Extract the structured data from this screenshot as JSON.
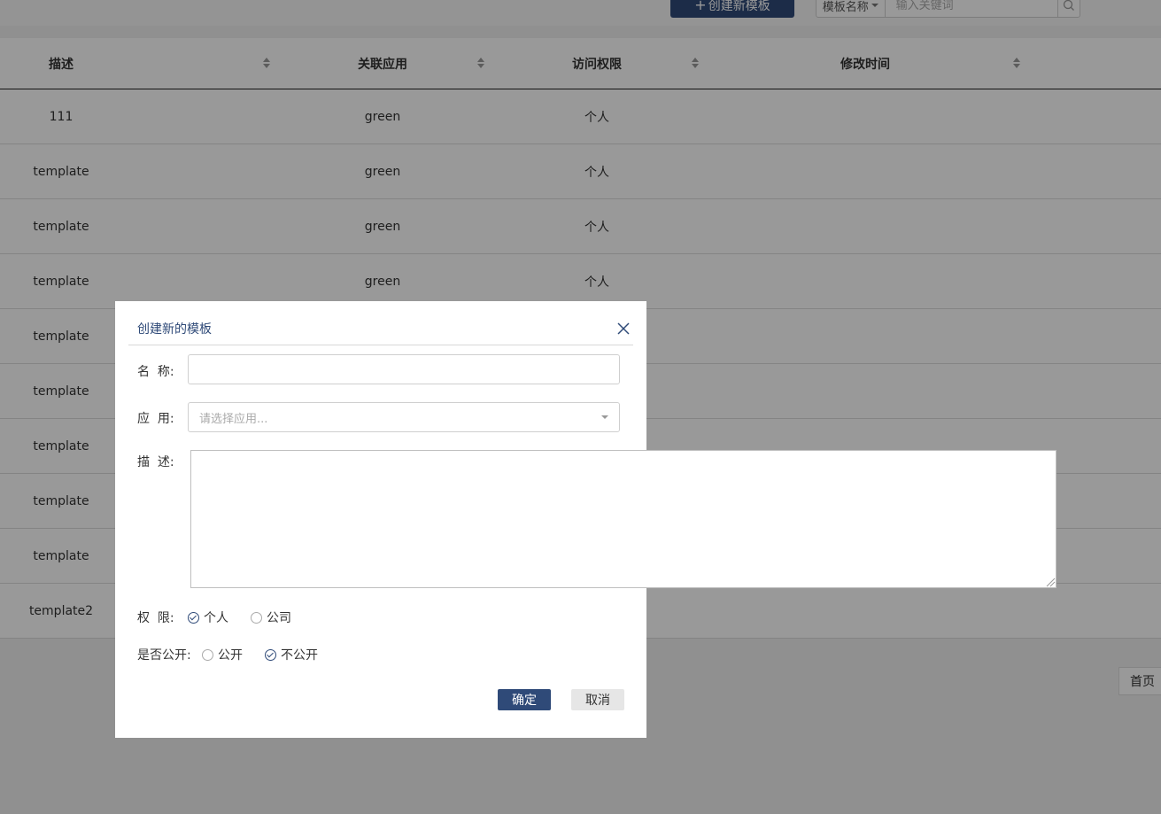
{
  "toolbar": {
    "create_label": "创建新模板",
    "search_type_label": "模板名称",
    "search_placeholder": "输入关键词"
  },
  "table": {
    "headers": [
      "描述",
      "关联应用",
      "访问权限",
      "修改时间"
    ],
    "rows": [
      {
        "desc": "111",
        "app": "green",
        "access": "个人",
        "time": ""
      },
      {
        "desc": "template",
        "app": "green",
        "access": "个人",
        "time": ""
      },
      {
        "desc": "template",
        "app": "green",
        "access": "个人",
        "time": ""
      },
      {
        "desc": "template",
        "app": "green",
        "access": "个人",
        "time": ""
      },
      {
        "desc": "template",
        "app": "",
        "access": "",
        "time": ""
      },
      {
        "desc": "template",
        "app": "",
        "access": "",
        "time": ""
      },
      {
        "desc": "template",
        "app": "",
        "access": "",
        "time": ""
      },
      {
        "desc": "template",
        "app": "",
        "access": "",
        "time": ""
      },
      {
        "desc": "template",
        "app": "",
        "access": "",
        "time": ""
      },
      {
        "desc": "template2",
        "app": "",
        "access": "",
        "time": ""
      }
    ]
  },
  "pagination": {
    "first_label": "首页"
  },
  "dialog": {
    "title": "创建新的模板",
    "name_label": "名  称:",
    "name_value": "",
    "app_label": "应  用:",
    "app_placeholder": "请选择应用...",
    "desc_label": "描  述:",
    "desc_value": "",
    "permission_label": "权  限:",
    "permission_options": [
      {
        "label": "个人",
        "selected": true
      },
      {
        "label": "公司",
        "selected": false
      }
    ],
    "public_label": "是否公开:",
    "public_options": [
      {
        "label": "公开",
        "selected": false
      },
      {
        "label": "不公开",
        "selected": true
      }
    ],
    "ok_label": "确定",
    "cancel_label": "取消"
  },
  "colors": {
    "primary": "#2f4a78",
    "mask": "rgba(0,0,0,0.4)"
  }
}
